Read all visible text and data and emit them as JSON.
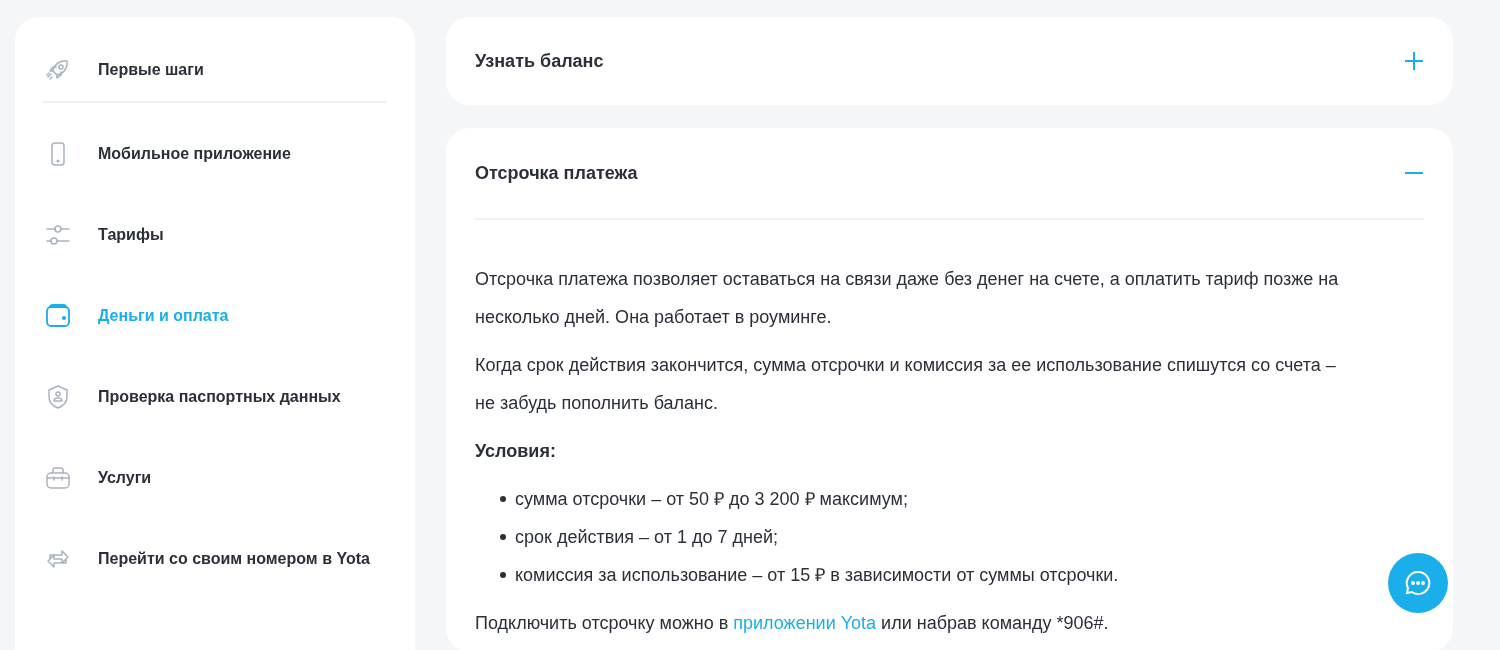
{
  "sidebar": {
    "items": [
      {
        "label": "Первые шаги",
        "kind": "rocket",
        "selected": false
      },
      {
        "label": "Мобильное приложение",
        "kind": "phone",
        "selected": false
      },
      {
        "label": "Тарифы",
        "kind": "sliders",
        "selected": false
      },
      {
        "label": "Деньги и оплата",
        "kind": "wallet",
        "selected": true
      },
      {
        "label": "Проверка паспортных данных",
        "kind": "shield",
        "selected": false
      },
      {
        "label": "Услуги",
        "kind": "bag",
        "selected": false
      },
      {
        "label": "Перейти со своим номером в Yota",
        "kind": "swap",
        "selected": false
      }
    ]
  },
  "accordion": [
    {
      "title": "Узнать баланс",
      "expanded": false
    },
    {
      "title": "Отсрочка платежа",
      "expanded": true,
      "content": [
        {
          "kind": "paragraph",
          "text": "Отсрочка платежа позволяет оставаться на связи даже без денег на счете, а оплатить тариф позже на несколько дней. Она работает в роуминге."
        },
        {
          "kind": "paragraph",
          "text": "Когда срок действия закончится, сумма отсрочки и комиссия за ее использование спишутся со счета – не забудь пополнить баланс."
        },
        {
          "kind": "heading",
          "text": "Условия:"
        },
        {
          "kind": "list",
          "items": [
            "сумма отсрочки – от 50 ₽ до 3 200 ₽ максимум;",
            "срок действия – от 1 до 7 дней;",
            "комиссия за использование – от 15 ₽ в зависимости от суммы отсрочки."
          ]
        },
        {
          "kind": "link_paragraph",
          "before": "Подключить отсрочку можно в ",
          "link": "приложении Yota",
          "after": " или набрав команду *906#."
        }
      ]
    }
  ]
}
